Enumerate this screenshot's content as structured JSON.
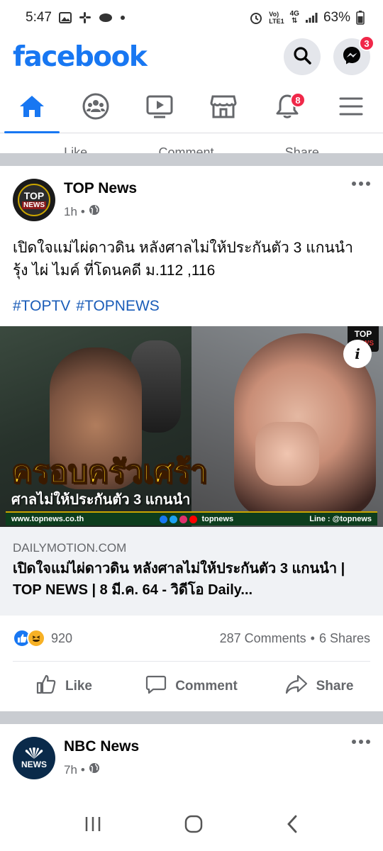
{
  "status_bar": {
    "time": "5:47",
    "network_top": "Vo)",
    "network_bottom": "LTE1",
    "net_type": "4G",
    "battery": "63%"
  },
  "header": {
    "logo": "facebook",
    "messenger_badge": "3",
    "brand_color": "#1877f2"
  },
  "nav": {
    "tabs": [
      {
        "name": "home-icon",
        "active": true
      },
      {
        "name": "groups-icon"
      },
      {
        "name": "watch-icon"
      },
      {
        "name": "marketplace-icon"
      },
      {
        "name": "notifications-icon",
        "badge": "8"
      },
      {
        "name": "menu-icon"
      }
    ]
  },
  "prev_post": {
    "like": "Like",
    "comment": "Comment",
    "share": "Share"
  },
  "post": {
    "author": "TOP News",
    "avatar_top": "TOP",
    "avatar_bottom": "NEWS",
    "time": "1h",
    "separator": "•",
    "text": "เปิดใจแม่ไผ่ดาวดิน หลังศาลไม่ให้ประกันตัว 3 แกนนำ รุ้ง ไผ่ ไมค์ ที่โดนคดี ม.112 ,116",
    "hashtags": [
      "#TOPTV",
      "#TOPNEWS"
    ],
    "media": {
      "headline": "ครอบครัวเศร้า",
      "subheadline": "ศาลไม่ให้ประกันตัว 3 แกนนำ",
      "site": "www.topnews.co.th",
      "social": "topnews",
      "line": "Line : @topnews",
      "corner_top": "TOP",
      "corner_bottom": "NEWS",
      "info": "i"
    },
    "link": {
      "domain": "DAILYMOTION.COM",
      "title": "เปิดใจแม่ไผ่ดาวดิน หลังศาลไม่ให้ประกันตัว 3 แกนนำ | TOP NEWS | 8 มี.ค. 64 - วิดีโอ Daily..."
    },
    "reactions": {
      "count": "920",
      "comments": "287 Comments",
      "dot": "•",
      "shares": "6 Shares"
    },
    "actions": {
      "like": "Like",
      "comment": "Comment",
      "share": "Share"
    }
  },
  "post2": {
    "author": "NBC News",
    "avatar_text": "NEWS",
    "time": "7h",
    "separator": "•"
  }
}
